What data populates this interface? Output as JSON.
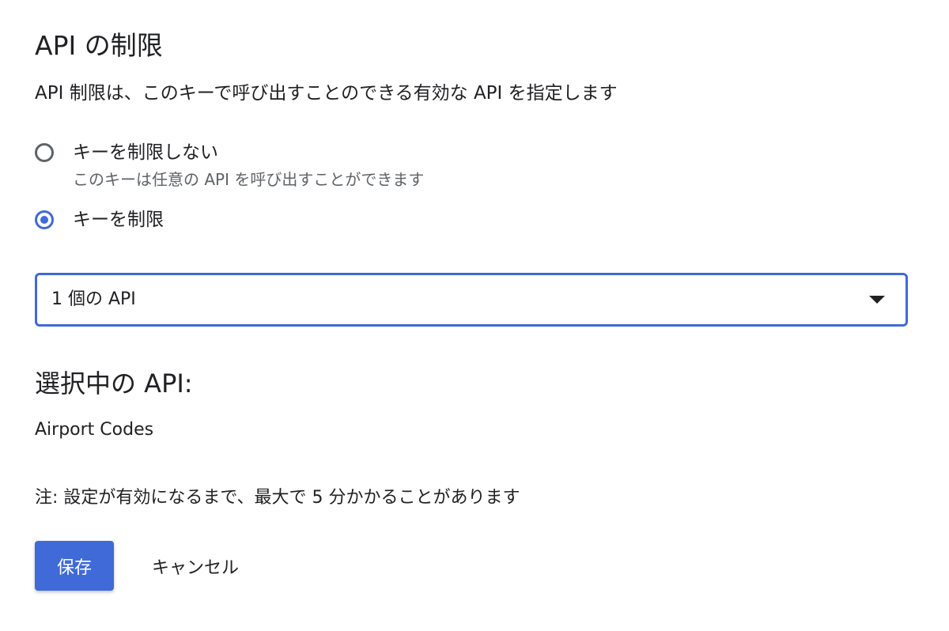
{
  "section": {
    "title": "API の制限",
    "description": "API 制限は、このキーで呼び出すことのできる有効な API を指定します"
  },
  "restriction_options": [
    {
      "label": "キーを制限しない",
      "sublabel": "このキーは任意の API を呼び出すことができます",
      "checked": false
    },
    {
      "label": "キーを制限",
      "checked": true
    }
  ],
  "api_select": {
    "value": "1 個の API",
    "icon": "arrow-drop-down"
  },
  "selected": {
    "heading": "選択中の API:",
    "apis": [
      "Airport Codes"
    ]
  },
  "note": "注: 設定が有効になるまで、最大で 5 分かかることがあります",
  "actions": {
    "save_label": "保存",
    "cancel_label": "キャンセル"
  },
  "colors": {
    "accent": "#3f6ad8",
    "text_primary": "#202124",
    "text_secondary": "#5f6368"
  }
}
